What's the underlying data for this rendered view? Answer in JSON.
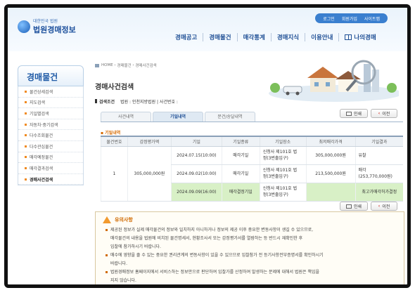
{
  "header": {
    "logo_small": "대한민국 법원",
    "logo_big": "법원경매정보",
    "top_links": [
      "로그인",
      "회원가입",
      "사이트맵"
    ],
    "nav": [
      "경매공고",
      "경매물건",
      "매각통계",
      "경매지식",
      "이용안내",
      "나의경매"
    ]
  },
  "sidebar": {
    "title": "경매물건",
    "items": [
      "물건상세검색",
      "지도검색",
      "기일별검색",
      "자동차·중기검색",
      "다수조회물건",
      "다수관심물건",
      "매각예정물건",
      "매각결과검색",
      "경매사건검색"
    ],
    "active_index": 8
  },
  "content": {
    "breadcrumb": [
      "HOME",
      "경매물건",
      "경매사건검색"
    ],
    "title": "경매사건검색",
    "cond_label": "검색조건",
    "cond_value": "법원 : 인천지방법원 | 사건번호 :",
    "tabs": [
      "사건내역",
      "기일내역",
      "문건/송달내역"
    ],
    "active_tab": 1,
    "print_label": "인쇄",
    "prev_label": "이전",
    "section_label": "기일내역",
    "table": {
      "headers": [
        "물건번호",
        "감정평가액",
        "기일",
        "기일종류",
        "기일장소",
        "최저매각가격",
        "기일결과"
      ],
      "item_no": "1",
      "appraisal": "305,000,000원",
      "rows": [
        {
          "date": "2024.07.15(10:00)",
          "type": "매각기일",
          "place1": "신청사 제101호 법",
          "place2": "정(3번출입구)",
          "min": "305,000,000원",
          "result1": "유찰",
          "result2": ""
        },
        {
          "date": "2024.09.02(10:00)",
          "type": "매각기일",
          "place1": "신청사 제101호 법",
          "place2": "정(3번출입구)",
          "min": "213,500,000원",
          "result1": "매각",
          "result2": "(253,770,000원)"
        },
        {
          "date": "2024.09.09(16:00)",
          "type": "매각결정기일",
          "place1": "신청사 제101호 법",
          "place2": "정(3번출입구)",
          "min": "",
          "result1": "최고가매각허가결정",
          "result2": ""
        }
      ]
    },
    "notice": {
      "title": "유의사항",
      "lines": [
        {
          "bullet": true,
          "text": "제공된 정보가 실제 매각물건의 정보와 일치하지 아니하거나 정보의 제공 이후 중요한 변동사항이 생길 수 있으므로,"
        },
        {
          "bullet": false,
          "text": "매각물건의 내용을 법원에 비치된 물건명세서, 현황조사서 또는 감정평가서를 열람하는 등 반드시 재확인한 후"
        },
        {
          "bullet": false,
          "text": "입찰에 참가하시기 바랍니다."
        },
        {
          "bullet": true,
          "text": "매수에 영향을 줄 수 있는 중요한 권리관계의 변동사항이 있을 수 있으므로 입찰참가 전 등기사항전부증명서를 확인하시기"
        },
        {
          "bullet": false,
          "text": "바랍니다."
        },
        {
          "bullet": true,
          "text": "법원경매정보 홈페이지에서 서비스하는 정보만으로 판단하여 입찰가를 산정하여 발생하는 문제에 대해서 법원은 책임을"
        },
        {
          "bullet": false,
          "text": "지지 않습니다."
        }
      ]
    }
  },
  "colors": {
    "accent": "#1f4f95",
    "highlight": "#d8f0c6",
    "warning": "#d06a00"
  }
}
